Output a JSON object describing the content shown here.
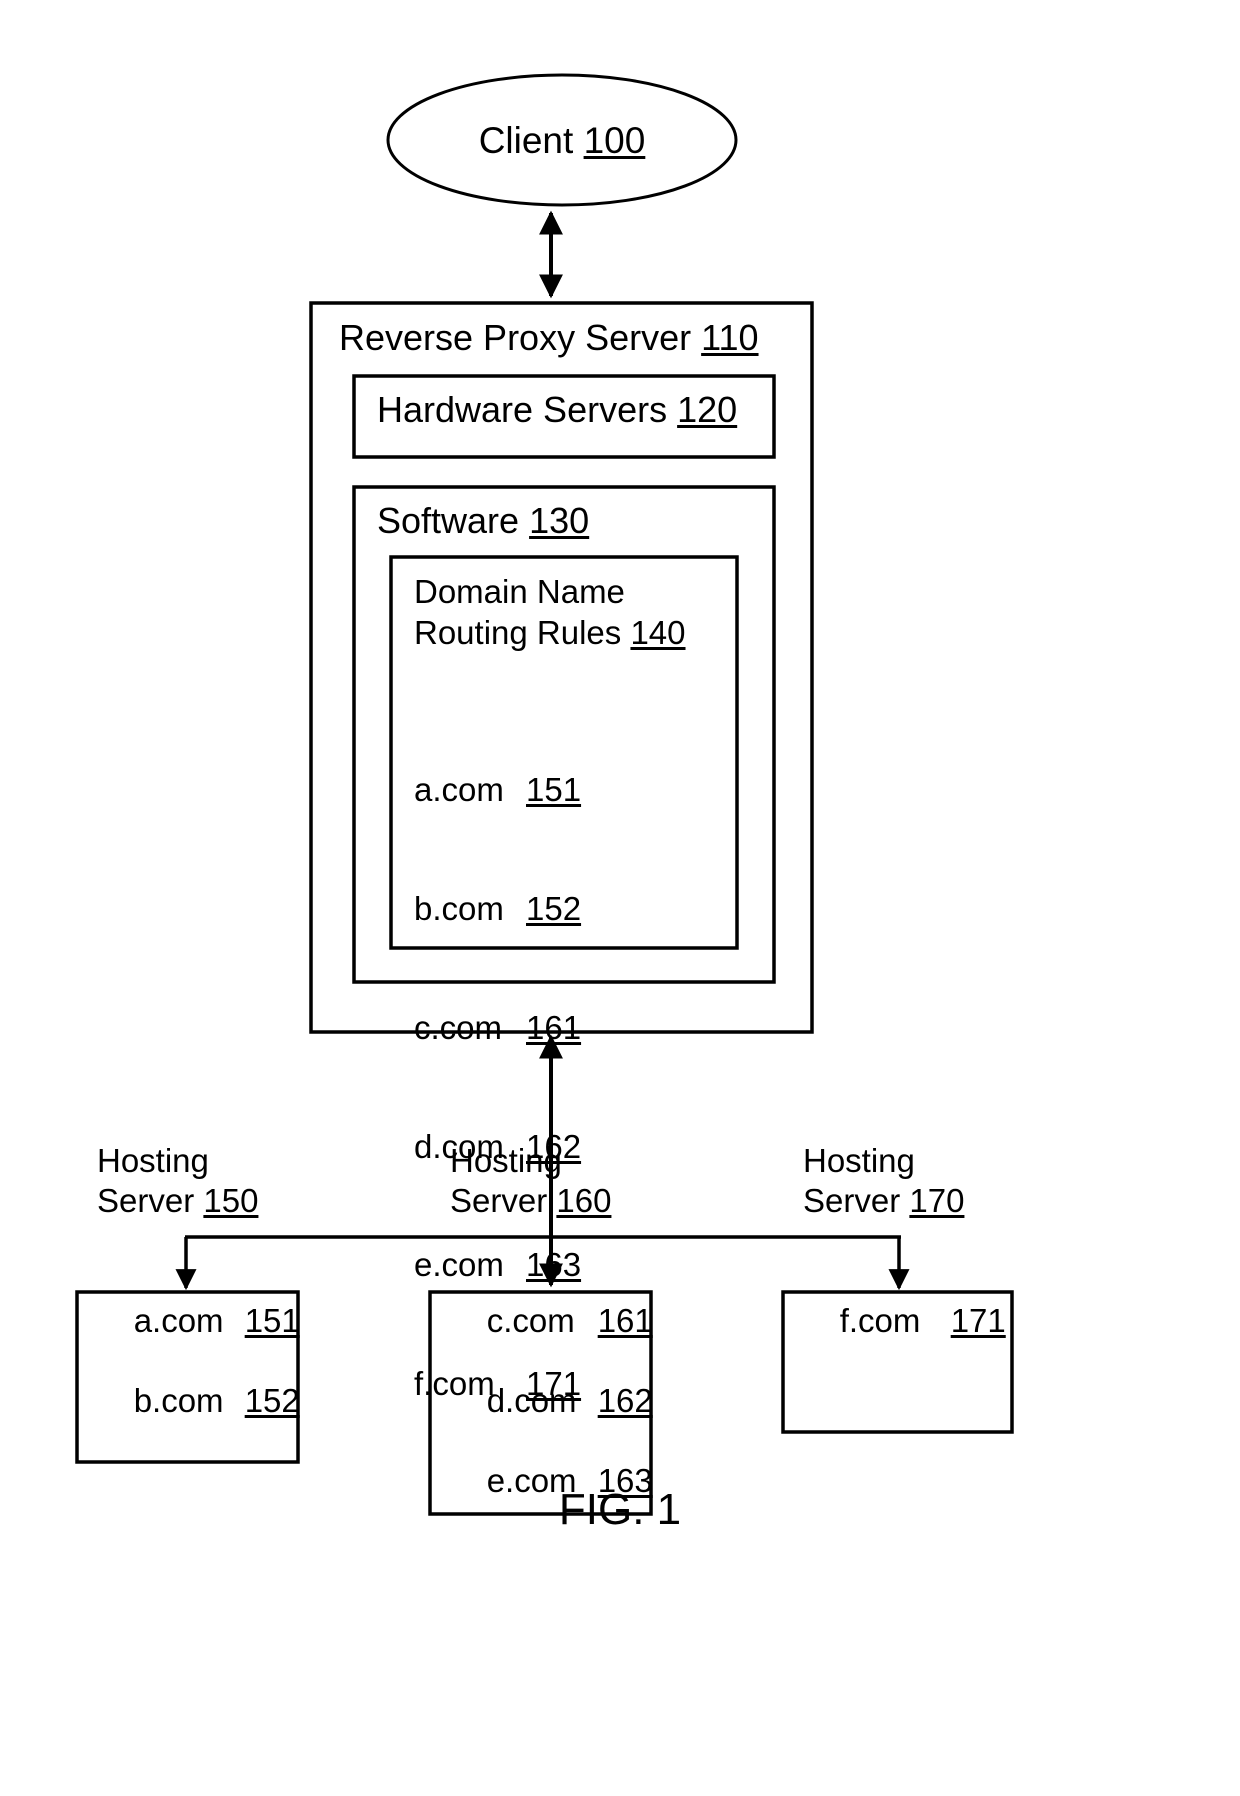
{
  "figure": {
    "caption": "FIG. 1",
    "client": {
      "label": "Client",
      "ref": "100"
    },
    "reverse_proxy": {
      "label": "Reverse Proxy Server",
      "ref": "110",
      "hardware_servers": {
        "label": "Hardware Servers",
        "ref": "120"
      },
      "software": {
        "label": "Software",
        "ref": "130",
        "routing_rules": {
          "label_line1": "Domain Name",
          "label_line2": "Routing Rules",
          "ref": "140",
          "entries": [
            {
              "domain": "a.com",
              "ref": "151"
            },
            {
              "domain": "b.com",
              "ref": "152"
            },
            {
              "domain": "c.com",
              "ref": "161"
            },
            {
              "domain": "d.com",
              "ref": "162"
            },
            {
              "domain": "e.com",
              "ref": "163"
            },
            {
              "domain": "f.com",
              "ref": "171"
            }
          ]
        }
      }
    },
    "hosting_servers": [
      {
        "label_line1": "Hosting",
        "label_line2": "Server",
        "ref": "150",
        "entries": [
          {
            "domain": "a.com",
            "ref": "151"
          },
          {
            "domain": "b.com",
            "ref": "152"
          }
        ]
      },
      {
        "label_line1": "Hosting",
        "label_line2": "Server",
        "ref": "160",
        "entries": [
          {
            "domain": "c.com",
            "ref": "161"
          },
          {
            "domain": "d.com",
            "ref": "162"
          },
          {
            "domain": "e.com",
            "ref": "163"
          }
        ]
      },
      {
        "label_line1": "Hosting",
        "label_line2": "Server",
        "ref": "170",
        "entries": [
          {
            "domain": "f.com",
            "ref": "171"
          }
        ]
      }
    ],
    "style": {
      "line_color": "#000000",
      "background": "#ffffff"
    }
  }
}
